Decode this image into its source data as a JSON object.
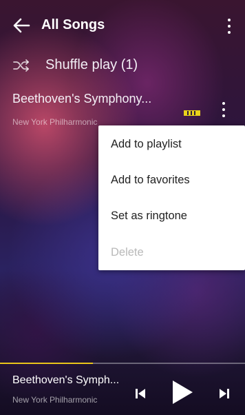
{
  "header": {
    "title": "All Songs"
  },
  "shuffle": {
    "label": "Shuffle play (1)"
  },
  "song": {
    "title": "Beethoven's Symphony...",
    "artist": "New York Philharmonic"
  },
  "context_menu": {
    "items": [
      {
        "label": "Add to playlist",
        "enabled": true
      },
      {
        "label": "Add to favorites",
        "enabled": true
      },
      {
        "label": "Set as ringtone",
        "enabled": true
      },
      {
        "label": "Delete",
        "enabled": false
      }
    ]
  },
  "player": {
    "title": "Beethoven's Symph...",
    "artist": "New York Philharmonic",
    "progress": 0.38
  },
  "colors": {
    "accent": "#e9c51a",
    "menu_background": "#ffffff",
    "menu_text": "#212121",
    "menu_disabled_text": "#b9b9b9"
  },
  "icons": [
    "back-arrow-icon",
    "more-vert-icon",
    "shuffle-icon",
    "equalizer-icon",
    "skip-previous-icon",
    "play-icon",
    "skip-next-icon"
  ]
}
